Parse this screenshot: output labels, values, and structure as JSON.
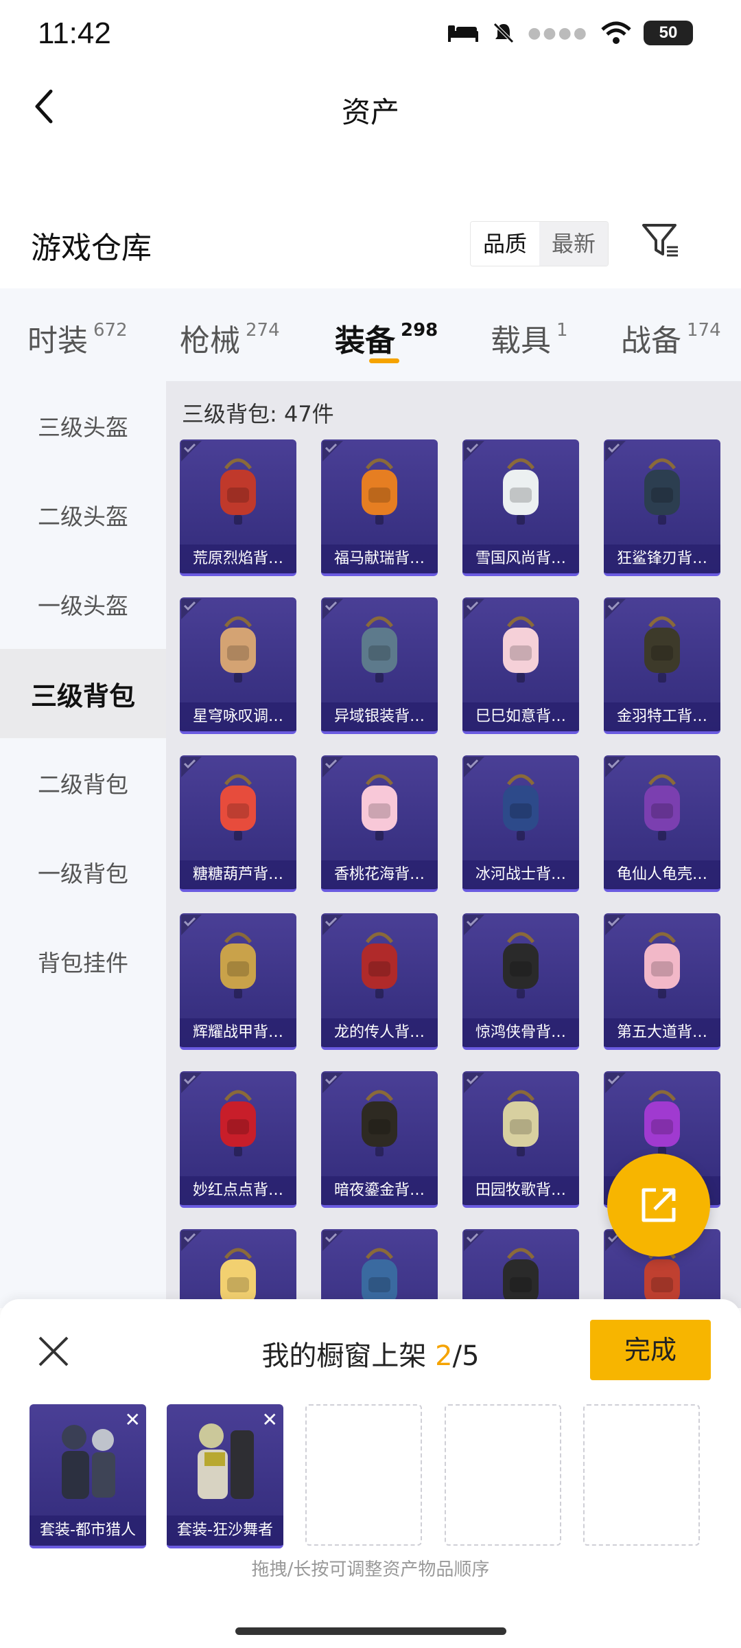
{
  "status_bar": {
    "time": "11:42",
    "battery": "50"
  },
  "header": {
    "title": "资产"
  },
  "warehouse": {
    "title": "游戏仓库",
    "sort": [
      "品质",
      "最新"
    ]
  },
  "tabs": [
    {
      "label": "时装",
      "count": "672"
    },
    {
      "label": "枪械",
      "count": "274"
    },
    {
      "label": "装备",
      "count": "298",
      "active": true
    },
    {
      "label": "载具",
      "count": "1"
    },
    {
      "label": "战备",
      "count": "174"
    }
  ],
  "sidebar": [
    {
      "label": "三级头盔"
    },
    {
      "label": "二级头盔"
    },
    {
      "label": "一级头盔"
    },
    {
      "label": "三级背包",
      "active": true
    },
    {
      "label": "二级背包"
    },
    {
      "label": "一级背包"
    },
    {
      "label": "背包挂件"
    }
  ],
  "grid": {
    "caption": "三级背包: 47件",
    "items": [
      {
        "name": "荒原烈焰背…",
        "color": "#c0392b"
      },
      {
        "name": "福马献瑞背…",
        "color": "#e67e22"
      },
      {
        "name": "雪国风尚背…",
        "color": "#ecf0f1"
      },
      {
        "name": "狂鲨锋刃背…",
        "color": "#2c3e50"
      },
      {
        "name": "星穹咏叹调…",
        "color": "#d4a373"
      },
      {
        "name": "异域银装背…",
        "color": "#5d7a8c"
      },
      {
        "name": "巳巳如意背…",
        "color": "#f5d0d8"
      },
      {
        "name": "金羽特工背…",
        "color": "#3d3a2a"
      },
      {
        "name": "糖糖葫芦背…",
        "color": "#e74c3c"
      },
      {
        "name": "香桃花海背…",
        "color": "#f8c8d8"
      },
      {
        "name": "冰河战士背…",
        "color": "#2d4a8a"
      },
      {
        "name": "龟仙人龟壳…",
        "color": "#7b3fb0"
      },
      {
        "name": "辉耀战甲背…",
        "color": "#c9a24a"
      },
      {
        "name": "龙的传人背…",
        "color": "#b02a2a"
      },
      {
        "name": "惊鸿侠骨背…",
        "color": "#2a2a2a"
      },
      {
        "name": "第五大道背…",
        "color": "#f2b8c8"
      },
      {
        "name": "妙红点点背…",
        "color": "#c81e2a"
      },
      {
        "name": "暗夜鎏金背…",
        "color": "#2e2a22"
      },
      {
        "name": "田园牧歌背…",
        "color": "#d8d0a0"
      },
      {
        "name": "",
        "color": "#a03ad0"
      },
      {
        "name": "",
        "color": "#f2d070"
      },
      {
        "name": "",
        "color": "#3a6aa0"
      },
      {
        "name": "",
        "color": "#2a2a2a"
      },
      {
        "name": "",
        "color": "#c04030"
      }
    ]
  },
  "sheet": {
    "title_prefix": "我的橱窗上架 ",
    "current": "2",
    "total": "/5",
    "done_label": "完成",
    "slots": [
      {
        "name": "套装-都市猎人",
        "filled": true
      },
      {
        "name": "套装-狂沙舞者",
        "filled": true
      },
      {
        "filled": false
      },
      {
        "filled": false
      },
      {
        "filled": false
      }
    ],
    "hint": "拖拽/长按可调整资产物品顺序"
  }
}
